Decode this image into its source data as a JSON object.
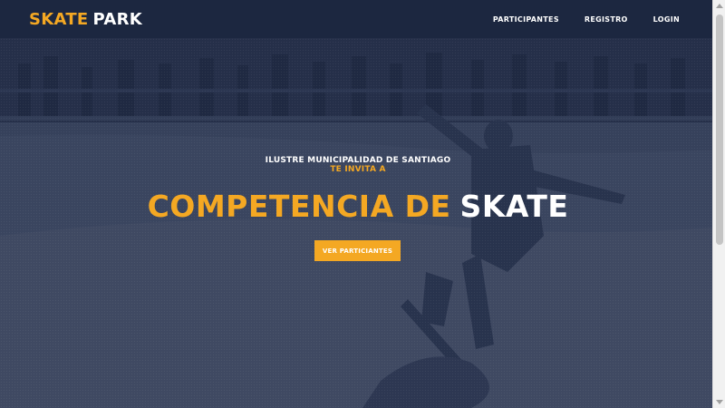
{
  "brand": {
    "part1": "SKATE",
    "part2": "PARK"
  },
  "nav": {
    "items": [
      {
        "label": "PARTICIPANTES"
      },
      {
        "label": "REGISTRO"
      },
      {
        "label": "LOGIN"
      }
    ]
  },
  "hero": {
    "presenter": "ILUSTRE MUNICIPALIDAD DE SANTIAGO",
    "invite": "TE INVITA A",
    "headline_part1": "COMPETENCIA DE",
    "headline_part2": "SKATE",
    "cta_label": "VER PARTICIANTES"
  },
  "colors": {
    "accent": "#f4a823",
    "navbar": "#1c2740",
    "overlay": "#1c2640",
    "text": "#ffffff"
  }
}
